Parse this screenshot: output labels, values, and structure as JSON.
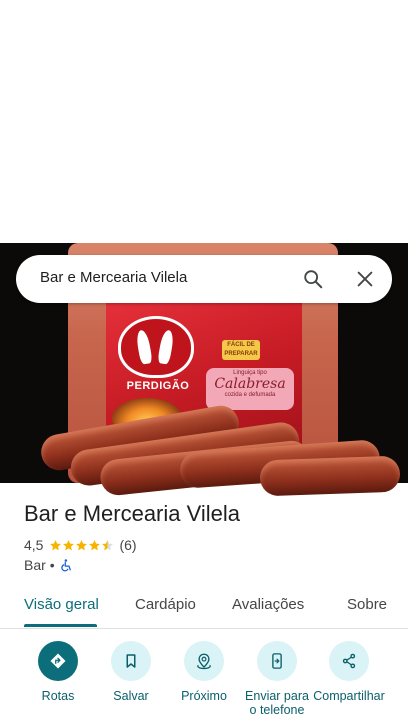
{
  "search": {
    "query": "Bar e Mercearia Vilela"
  },
  "photo": {
    "brand": "PERDIGÃO",
    "badge": "FÁCIL DE PREPARAR",
    "product_type": "Linguiça tipo",
    "product_name": "Calabresa",
    "product_desc": "cozida e defumada"
  },
  "place": {
    "title": "Bar e Mercearia Vilela",
    "rating": "4,5",
    "stars": 4.5,
    "review_count": "(6)",
    "category": "Bar",
    "separator": "•"
  },
  "tabs": [
    {
      "label": "Visão geral",
      "active": true
    },
    {
      "label": "Cardápio",
      "active": false
    },
    {
      "label": "Avaliações",
      "active": false
    },
    {
      "label": "Sobre",
      "active": false
    }
  ],
  "actions": [
    {
      "label": "Rotas",
      "icon": "directions-icon"
    },
    {
      "label": "Salvar",
      "icon": "bookmark-icon"
    },
    {
      "label": "Próximo",
      "icon": "nearby-icon"
    },
    {
      "label": "Enviar para o telefone",
      "icon": "send-to-phone-icon"
    },
    {
      "label": "Compartilhar",
      "icon": "share-icon"
    }
  ],
  "colors": {
    "accent": "#0b6e7a",
    "action_bg": "#d9f3f6",
    "star": "#f5b400"
  }
}
